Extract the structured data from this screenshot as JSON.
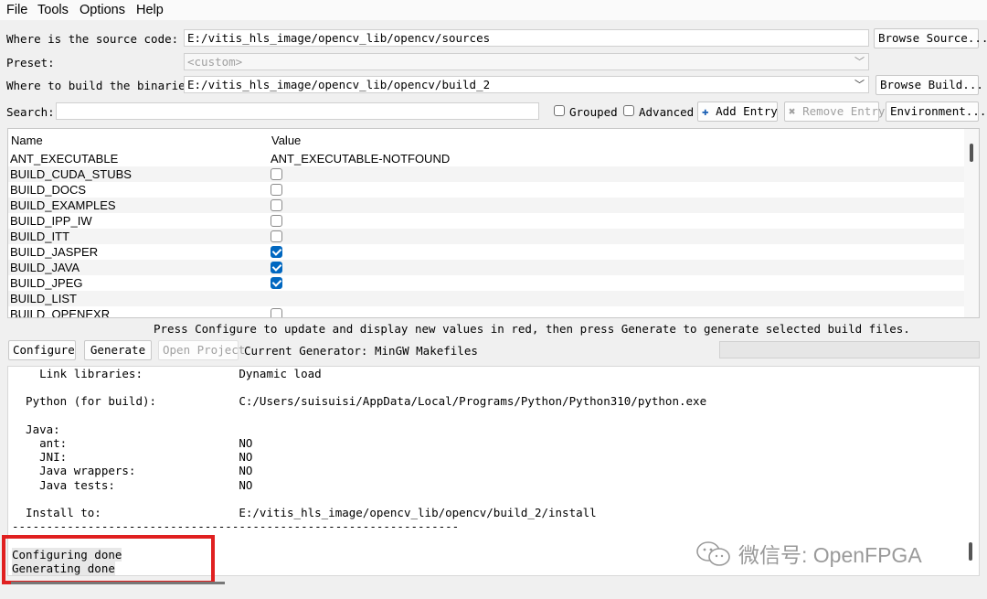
{
  "menu": [
    "File",
    "Tools",
    "Options",
    "Help"
  ],
  "source": {
    "label": "Where is the source code:",
    "value": "E:/vitis_hls_image/opencv_lib/opencv/sources",
    "button": "Browse Source..."
  },
  "preset": {
    "label": "Preset:",
    "value": "<custom>"
  },
  "build": {
    "label": "Where to build the binaries:",
    "value": "E:/vitis_hls_image/opencv_lib/opencv/build_2",
    "button": "Browse Build..."
  },
  "search": {
    "label": "Search:",
    "value": ""
  },
  "filters": {
    "grouped": "Grouped",
    "advanced": "Advanced"
  },
  "entry_buttons": {
    "add": "Add Entry",
    "remove": "Remove Entry",
    "environment": "Environment..."
  },
  "table": {
    "headers": [
      "Name",
      "Value"
    ],
    "rows": [
      {
        "name": "ANT_EXECUTABLE",
        "value": "ANT_EXECUTABLE-NOTFOUND",
        "checkbox": null
      },
      {
        "name": "BUILD_CUDA_STUBS",
        "value": "",
        "checkbox": false
      },
      {
        "name": "BUILD_DOCS",
        "value": "",
        "checkbox": false
      },
      {
        "name": "BUILD_EXAMPLES",
        "value": "",
        "checkbox": false
      },
      {
        "name": "BUILD_IPP_IW",
        "value": "",
        "checkbox": false
      },
      {
        "name": "BUILD_ITT",
        "value": "",
        "checkbox": false
      },
      {
        "name": "BUILD_JASPER",
        "value": "",
        "checkbox": true
      },
      {
        "name": "BUILD_JAVA",
        "value": "",
        "checkbox": true
      },
      {
        "name": "BUILD_JPEG",
        "value": "",
        "checkbox": true
      },
      {
        "name": "BUILD_LIST",
        "value": "",
        "checkbox": null
      },
      {
        "name": "BUILD_OPENEXR",
        "value": "",
        "checkbox": false
      }
    ]
  },
  "hint": "Press Configure to update and display new values in red, then press Generate to generate selected build files.",
  "actions": {
    "configure": "Configure",
    "generate": "Generate",
    "open_project": "Open Project",
    "generator": "Current Generator: MinGW Makefiles"
  },
  "output": [
    "    Link libraries:              Dynamic load",
    "",
    "  Python (for build):            C:/Users/suisuisi/AppData/Local/Programs/Python/Python310/python.exe",
    "",
    "  Java:",
    "    ant:                         NO",
    "    JNI:                         NO",
    "    Java wrappers:               NO",
    "    Java tests:                  NO",
    "",
    "  Install to:                    E:/vitis_hls_image/opencv_lib/opencv/build_2/install",
    "-----------------------------------------------------------------",
    "",
    "Configuring done",
    "Generating done"
  ],
  "watermark": "微信号: OpenFPGA"
}
